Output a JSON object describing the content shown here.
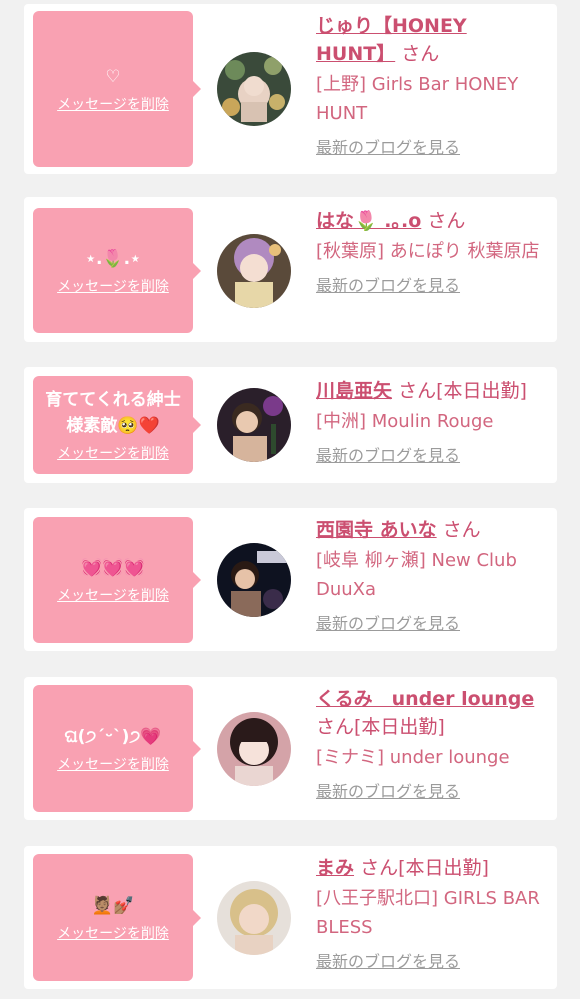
{
  "common": {
    "delete_label": "メッセージを削除",
    "san": "さん",
    "blog_link": "最新のブログを見る"
  },
  "entries": [
    {
      "message": "♡",
      "name": "じゅり【HONEY HUNT】",
      "san_suffix": "さん",
      "shop": "[上野] Girls Bar HONEY HUNT"
    },
    {
      "message": "⋆.🌷.⋆",
      "name": "はな🌷 .｡.o",
      "san_suffix": "さん",
      "shop": "[秋葉原] あにぽり 秋葉原店"
    },
    {
      "message": "育ててくれる紳士様素敵🥺❤️",
      "name": "川島亜矢",
      "san_suffix": "さん[本日出勤]",
      "shop": "[中洲] Moulin Rouge"
    },
    {
      "message": "💓💓💓",
      "name": "西園寺 あいな",
      "san_suffix": "さん",
      "shop": "[岐阜 柳ヶ瀬] New Club DuuXa"
    },
    {
      "message": "ଘ(੭ˊᵕˋ)੭💗",
      "name": "くるみ　under lounge",
      "san_suffix": "さん[本日出勤]",
      "shop": "[ミナミ] under lounge"
    },
    {
      "message": "💆🏽💅🏽",
      "name": "まみ",
      "san_suffix": "さん[本日出勤]",
      "shop": "[八王子駅北口] GIRLS BAR BLESS"
    }
  ],
  "colors": {
    "background": "#f1f1f1",
    "bubble": "#f9a1b2",
    "name": "#cb4f70",
    "shop": "#d2667f",
    "blog_link": "#9b9b9b"
  },
  "icons": [
    "avatar-photo"
  ]
}
